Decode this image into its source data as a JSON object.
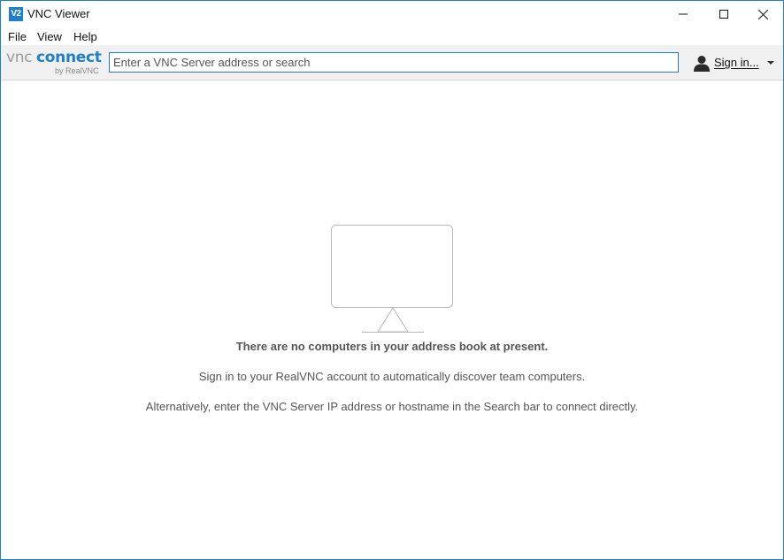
{
  "window": {
    "title": "VNC Viewer",
    "app_icon_text": "V2",
    "accent_color": "#1f7fc8"
  },
  "menu": {
    "items": [
      "File",
      "View",
      "Help"
    ]
  },
  "toolbar": {
    "logo_vnc": "vnc",
    "logo_connect": "connect",
    "logo_by": "by RealVNC",
    "search_placeholder": "Enter a VNC Server address or search",
    "search_value": "",
    "signin_label": "Sign in...",
    "icons": [
      "user-icon",
      "chevron-down-icon"
    ]
  },
  "empty_state": {
    "icon": "monitor-icon",
    "heading": "There are no computers in your address book at present.",
    "line1": "Sign in to your RealVNC account to automatically discover team computers.",
    "line2": "Alternatively, enter the VNC Server IP address or hostname in the Search bar to connect directly."
  }
}
